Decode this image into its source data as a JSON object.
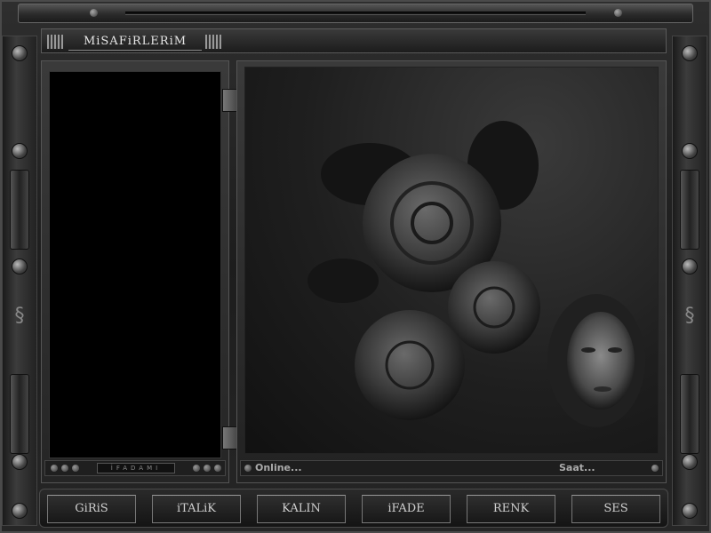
{
  "window": {
    "title": "MiSAFiRLERiM"
  },
  "sidebar": {
    "footer_label": "İFADAMI"
  },
  "status": {
    "online_label": "Online...",
    "clock_label": "Saat..."
  },
  "buttons": [
    {
      "id": "giris",
      "label": "GiRiS"
    },
    {
      "id": "italik",
      "label": "iTALiK"
    },
    {
      "id": "kalin",
      "label": "KALIN"
    },
    {
      "id": "ifade",
      "label": "iFADE"
    },
    {
      "id": "renk",
      "label": "RENK"
    },
    {
      "id": "ses",
      "label": "SES"
    }
  ],
  "colors": {
    "frame": "#2a2a2a",
    "panel_black": "#000000",
    "accent": "#cfcfcf"
  }
}
